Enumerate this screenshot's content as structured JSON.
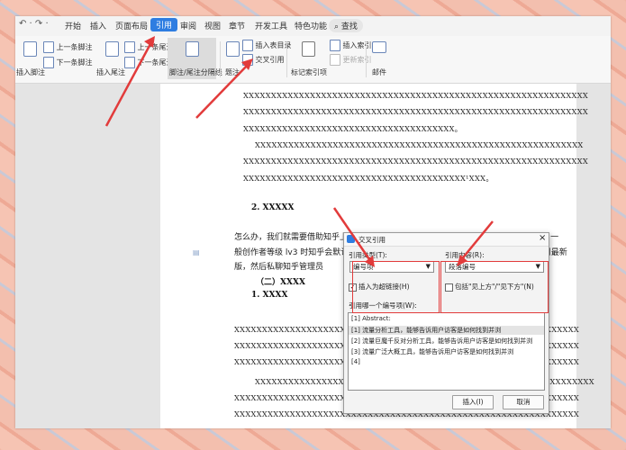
{
  "menubar": {
    "undo": "↶ · ↷ ·",
    "tabs": [
      "开始",
      "插入",
      "页面布局",
      "引用",
      "审阅",
      "视图",
      "章节",
      "开发工具",
      "特色功能"
    ],
    "active_tab": "引用",
    "search": "查找"
  },
  "ribbon": {
    "insert_footnote": "插入脚注",
    "prev_footnote": "上一条脚注",
    "next_footnote": "下一条脚注",
    "insert_endnote": "插入尾注",
    "prev_endnote": "上一条尾注",
    "next_endnote": "下一条尾注",
    "separator": "脚注/尾注分隔线",
    "caption": "题注",
    "insert_table_of_figures": "插入表目录",
    "cross_reference": "交叉引用",
    "mark_index_entry": "标记索引项",
    "insert_index": "插入索引",
    "update_index": "更新索引",
    "mail": "邮件"
  },
  "document": {
    "line1": "XXXXXXXXXXXXXXXXXXXXXXXXXXXXXXXXXXXXXXXXXXXXXXXXXXXXXXXXXXXXXX",
    "line2": "XXXXXXXXXXXXXXXXXXXXXXXXXXXXXXXXXXXXXXXXXXXXXXXXXXXXXXXXXXXXXX",
    "line3": "XXXXXXXXXXXXXXXXXXXXXXXXXXXXXXXXXXXXXX。",
    "line4": "XXXXXXXXXXXXXXXXXXXXXXXXXXXXXXXXXXXXXXXXXXXXXXXXXXXXXXXXXXX",
    "line5": "XXXXXXXXXXXXXXXXXXXXXXXXXXXXXXXXXXXXXXXXXXXXXXXXXXXXXXXXXXXXXX",
    "line6": "XXXXXXXXXXXXXXXXXXXXXXXXXXXXXXXXXXXXXXXX¹XXX。",
    "heading2": "2. XXXXX",
    "para1": "怎么办，我们就需要借助知乎上线的图文转视频功能（知乎 app 最新版才有这个功能），一",
    "para2": "般创作者等级 lv3 时知乎会默认开通，如果没有这[1]个功能，可以先把知乎 app 升级到最新",
    "para3": "版，然后私聊知乎管理员",
    "subhead": "（二）XXXX",
    "heading1": "1. XXXX",
    "line7": "XXXXXXXXXXXXXXXXXXXXXXXXXXXXXXXXXXXXXXXXXXXXXXXXXXXXXXXXXXXXXX",
    "line8": "XXXXXXXXXXXXXXXXXXXXXXXXXXXXXXXXXXXXXXXXXXXXXXXXXXXXXXXXXXXXXX",
    "line9": "XXXXXXXXXXXXXXXXXXXXXXXXXXXXXXXXXXXXXXXXXXXXXXXXXXXXXXXXXXXXXX",
    "line10": "XXXXXXXXXXXXXXXXXXXXXXXXXXXXXXXXXXXXXXXXXXXXXXXXXXXXXXXXXXXXX",
    "line11": "XXXXXXXXXXXXXXXXXXXXXXXXXXXXXXXXXXXXXXXXXXXXXXXXXXXXXXXXXXXXXX",
    "line12": "XXXXXXXXXXXXXXXXXXXXXXXXXXXXXXXXXXXXXXXXXXXXXXXXXXXXXXXXXXXXXX"
  },
  "dialog": {
    "title": "交叉引用",
    "close": "×",
    "ref_type_label": "引用类型(T):",
    "ref_type_value": "编号项",
    "ref_content_label": "引用内容(R):",
    "ref_content_value": "段落编号",
    "insert_hyperlink": "插入为超链接(H)",
    "include_above_below": "包括\"见上方\"/\"见下方\"(N)",
    "which_item_label": "引用哪一个编号项(W):",
    "items": [
      "[1] Abstract:",
      "[1] 流量分析工具，能够告诉用户访客是如何找到并浏",
      "[2] 流量巨魔千反对分析工具，能够告诉用户访客是如何找到并浏",
      "[3] 流量广泛大概工具，能够告诉用户访客是如何找到并浏",
      "[4]"
    ],
    "insert_button": "插入(I)",
    "cancel_button": "取消"
  },
  "colors": {
    "accent": "#2e7de1",
    "annotation_red": "#e23b3b"
  }
}
